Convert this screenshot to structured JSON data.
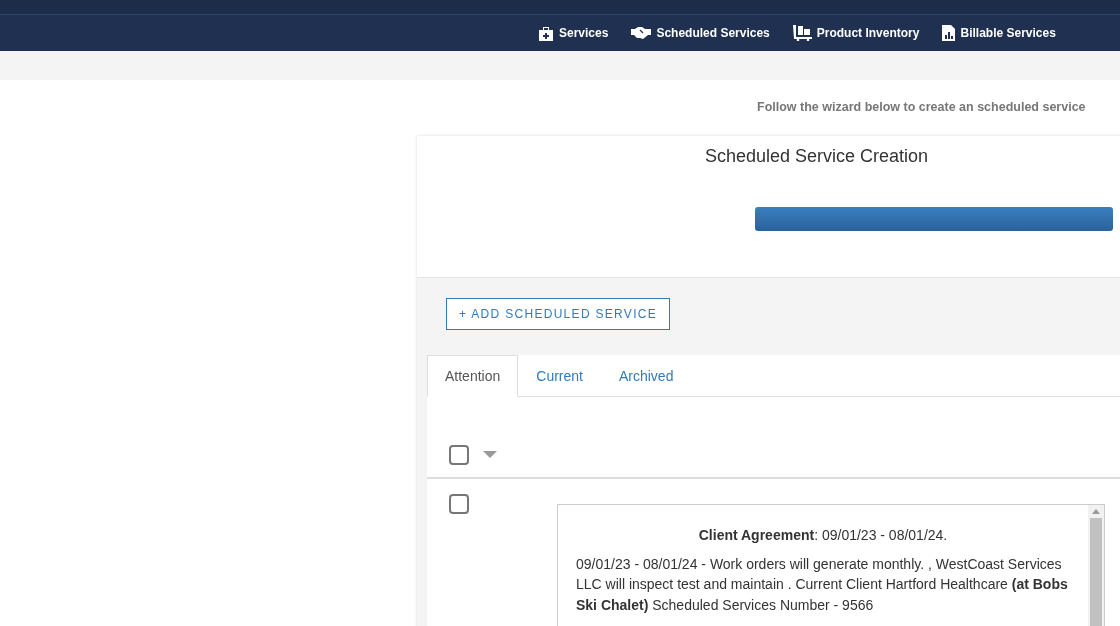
{
  "nav": {
    "items": [
      {
        "label": "Services"
      },
      {
        "label": "Scheduled Services"
      },
      {
        "label": "Product Inventory"
      },
      {
        "label": "Billable Services"
      }
    ]
  },
  "intro": "Follow the wizard below to create an scheduled service",
  "wizard": {
    "title": "Scheduled Service Creation"
  },
  "add_button": "+ ADD SCHEDULED SERVICE",
  "tabs": [
    {
      "label": "Attention",
      "selected": true
    },
    {
      "label": "Current",
      "selected": false
    },
    {
      "label": "Archived",
      "selected": false
    }
  ],
  "select_all": {
    "checked": false
  },
  "rows": [
    {
      "checked": false,
      "heading": "**Client Agreement**: 09/01/23 - 08/01/24.",
      "body": "09/01/23 - 08/01/24 - Work orders will generate monthly. , WestCoast Services LLC will inspect test and maintain . Current Client Hartford Healthcare **(at Bobs Ski Chalet)** Scheduled Services Number - 9566"
    }
  ]
}
